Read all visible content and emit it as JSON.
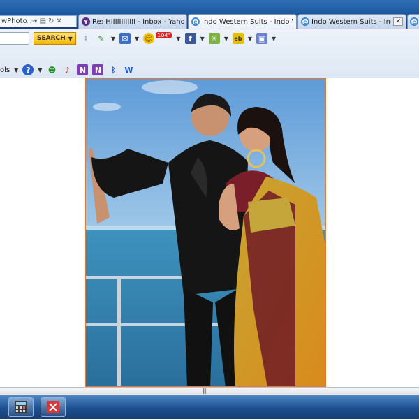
{
  "tabs": {
    "address_fragment": "wPhoto.ph",
    "items": [
      {
        "label": "Re: HIIIIIIIIIIII - Inbox - Yahoo...",
        "icon": "yahoo-mail-icon"
      },
      {
        "label": "Indo Western Suits - Indo West...",
        "icon": "ie-icon"
      },
      {
        "label": "Indo Western Suits - Indo West...",
        "icon": "ie-icon"
      }
    ]
  },
  "toolbar": {
    "search_label": "SEARCH",
    "mail_badge": "104°",
    "tools_label": "ols"
  },
  "colors": {
    "photo_border": "#e07a3a",
    "search_button": "#f4b400",
    "taskbar": "#1d4f8f"
  },
  "content": {
    "image_description_icon": "photo-image"
  }
}
